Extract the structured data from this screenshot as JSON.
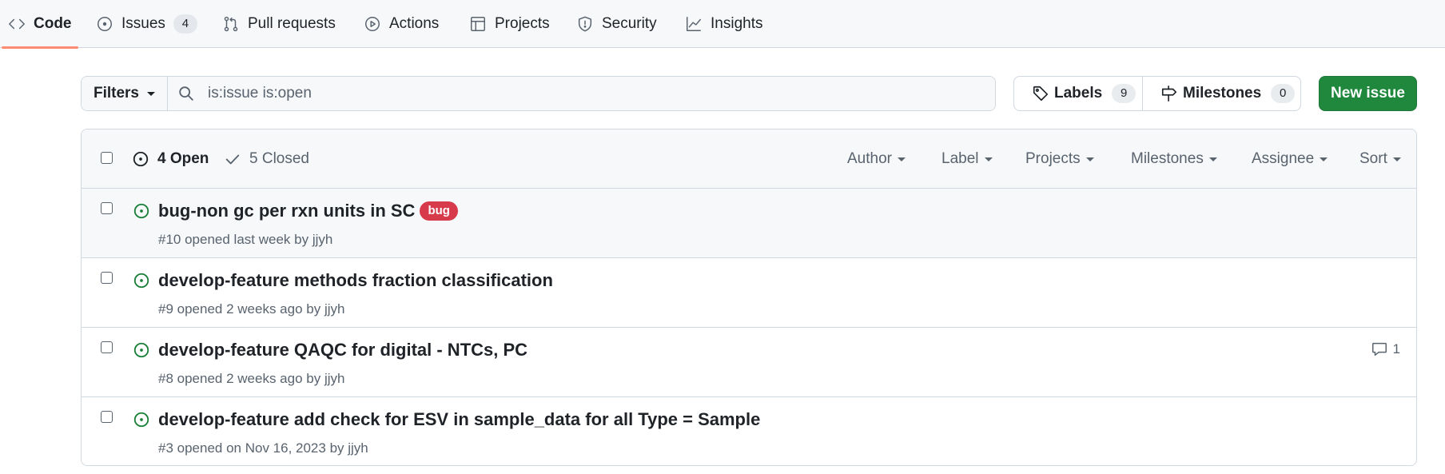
{
  "nav": {
    "tabs": [
      {
        "label": "Code",
        "icon": "code-icon",
        "selected": true
      },
      {
        "label": "Issues",
        "icon": "issue-opened-icon",
        "count": "4"
      },
      {
        "label": "Pull requests",
        "icon": "git-pull-request-icon"
      },
      {
        "label": "Actions",
        "icon": "play-icon"
      },
      {
        "label": "Projects",
        "icon": "table-icon"
      },
      {
        "label": "Security",
        "icon": "shield-icon"
      },
      {
        "label": "Insights",
        "icon": "graph-icon"
      }
    ]
  },
  "subnav": {
    "filters_label": "Filters",
    "search_value": "is:issue is:open",
    "labels_label": "Labels",
    "labels_count": "9",
    "milestones_label": "Milestones",
    "milestones_count": "0",
    "new_issue_label": "New issue"
  },
  "list_header": {
    "open_label": "4 Open",
    "closed_label": "5 Closed",
    "filters": [
      "Author",
      "Label",
      "Projects",
      "Milestones",
      "Assignee",
      "Sort"
    ]
  },
  "issues": [
    {
      "title": "bug-non gc per rxn units in SC",
      "label": "bug",
      "meta_prefix": "#10 opened last week by ",
      "author": "jjyh"
    },
    {
      "title": "develop-feature methods fraction classification",
      "meta_prefix": "#9 opened 2 weeks ago by ",
      "author": "jjyh"
    },
    {
      "title": "develop-feature QAQC for digital - NTCs, PC",
      "meta_prefix": "#8 opened 2 weeks ago by ",
      "author": "jjyh",
      "comments": "1"
    },
    {
      "title": "develop-feature add check for ESV in sample_data for all Type = Sample",
      "meta_prefix": "#3 opened on Nov 16, 2023 by ",
      "author": "jjyh"
    }
  ],
  "colors": {
    "open_icon": "#1a7f37",
    "new_issue_bg": "#1f883d",
    "bug_label": "#d73a4a",
    "selected_tab_underline": "#fd8c73"
  }
}
